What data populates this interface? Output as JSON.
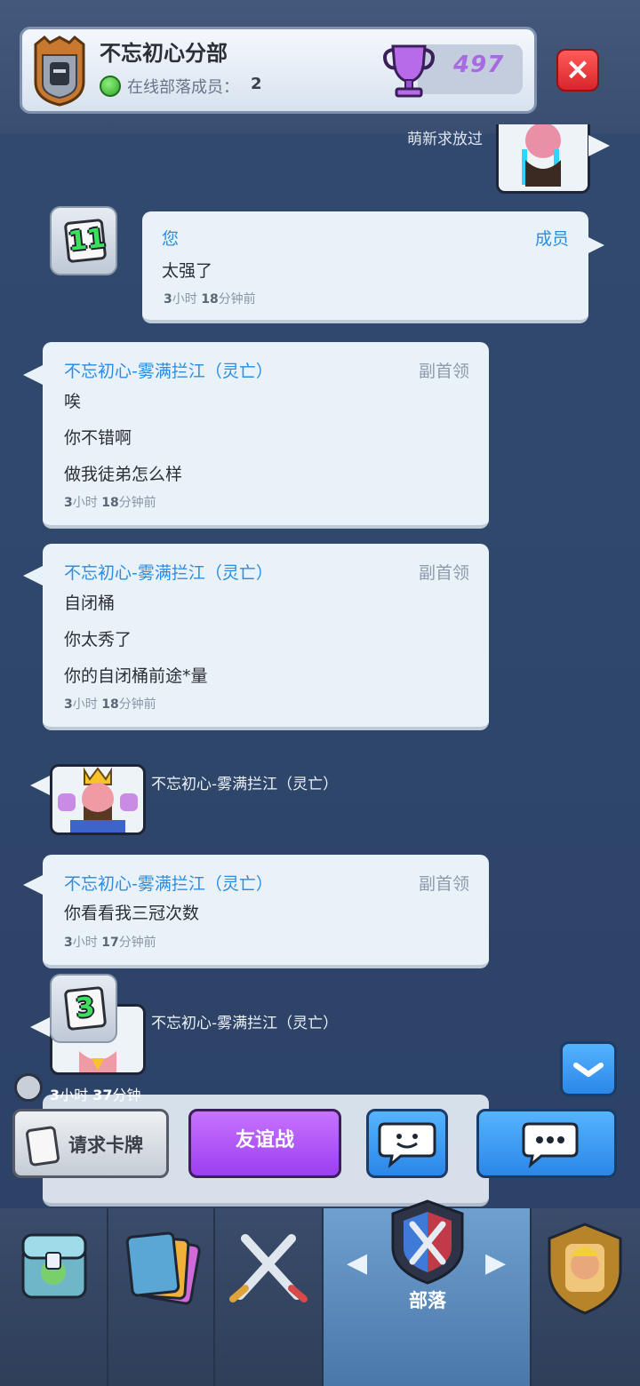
{
  "header": {
    "clan_name": "不忘初心分部",
    "online_label": "在线部落成员：",
    "online_count": "2",
    "trophies": "497",
    "close_icon": "close-icon"
  },
  "chat": {
    "top_partial_text": "萌新求放过",
    "my_message": {
      "sender": "您",
      "role": "成员",
      "text": "太强了",
      "time_h": "3",
      "time_h_unit": "小时 ",
      "time_m": "18",
      "time_m_unit": "分钟前",
      "card_level": "11"
    },
    "messages": [
      {
        "sender": "不忘初心-雾满拦江（灵亡）",
        "role": "副首领",
        "lines": [
          "唉",
          "你不错啊",
          "做我徒弟怎么样"
        ],
        "time_h": "3",
        "time_m": "18"
      },
      {
        "sender": "不忘初心-雾满拦江（灵亡）",
        "role": "副首领",
        "lines": [
          "自闭桶",
          "你太秀了",
          "你的自闭桶前途*量"
        ],
        "time_h": "3",
        "time_m": "18"
      },
      {
        "sender": "不忘初心-雾满拦江（灵亡）",
        "role": "副首领",
        "lines": [
          "你看看我三冠次数"
        ],
        "time_h": "3",
        "time_m": "17"
      }
    ],
    "emote1_name": "不忘初心-雾满拦江（灵亡）",
    "emote2_name": "不忘初心-雾满拦江（灵亡）",
    "emote2_card_level": "3",
    "time_unit_h": "小时 ",
    "time_unit_m": "分钟前"
  },
  "controls": {
    "timer_h": "3",
    "timer_h_unit": "小时 ",
    "timer_m": "37",
    "timer_m_unit": "分钟",
    "request_cards": "请求卡牌",
    "friendly_battle": "友谊战",
    "emote_icon": "smiley-chat-icon",
    "chat_icon": "chat-bubble-icon",
    "scroll_down_icon": "chevron-down-icon"
  },
  "nav": {
    "clan_label": "部落",
    "tabs": [
      "shop-icon",
      "cards-icon",
      "battle-icon",
      "clan-icon",
      "events-icon"
    ]
  },
  "colors": {
    "accent_blue": "#2a8de3",
    "purple": "#9b3ff0",
    "red": "#d8262b"
  }
}
